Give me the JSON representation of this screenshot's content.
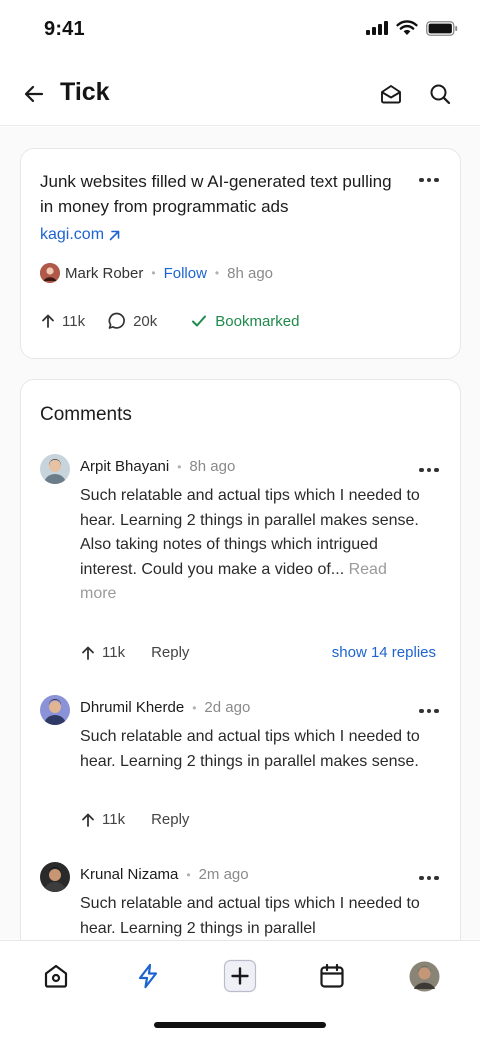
{
  "status_bar": {
    "time": "9:41"
  },
  "header": {
    "title": "Tick"
  },
  "post": {
    "title": "Junk websites filled w AI-generated text pulling in money from programmatic ads",
    "source": "kagi.com",
    "author": "Mark Rober",
    "follow_label": "Follow",
    "time_ago": "8h ago",
    "upvotes": "11k",
    "comments": "20k",
    "bookmark_label": "Bookmarked"
  },
  "comments_section": {
    "heading": "Comments",
    "items": [
      {
        "author": "Arpit Bhayani",
        "time_ago": "8h ago",
        "text": "Such relatable and actual tips which I needed to hear. Learning 2 things in parallel makes sense.\nAlso taking notes of things which intrigued interest. Could you make a video of...",
        "read_more": "Read more",
        "upvotes": "11k",
        "reply_label": "Reply",
        "show_replies": "show 14 replies"
      },
      {
        "author": "Dhrumil Kherde",
        "time_ago": "2d ago",
        "text": "Such relatable and actual tips which I needed to hear. Learning 2 things in parallel makes sense.",
        "upvotes": "11k",
        "reply_label": "Reply"
      },
      {
        "author": "Krunal Nizama",
        "time_ago": "2m ago",
        "text": "Such relatable and actual tips which I needed to hear. Learning 2 things in parallel"
      }
    ]
  },
  "tabbar": {
    "tabs": [
      "home-icon",
      "lightning-icon",
      "add-icon",
      "calendar-icon",
      "profile-avatar"
    ],
    "active": "lightning-icon"
  },
  "colors": {
    "accent": "#1d64d0",
    "success": "#1f8a4c"
  }
}
